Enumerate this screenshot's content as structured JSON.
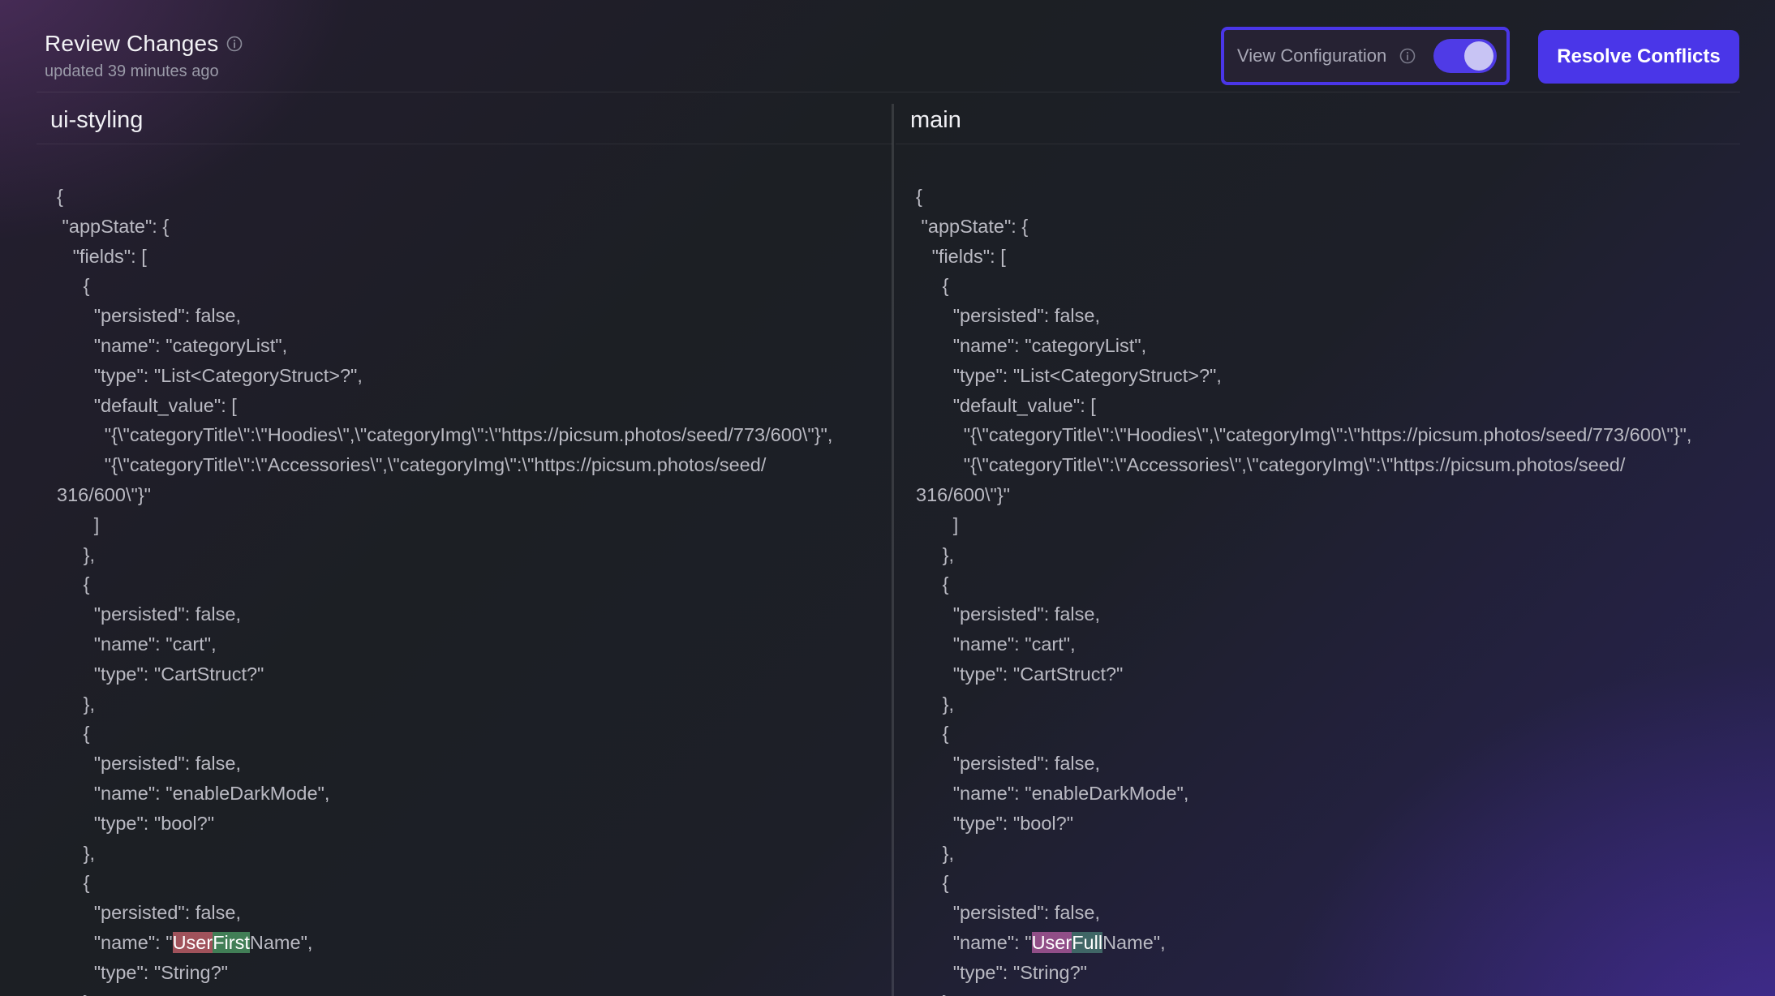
{
  "header": {
    "title": "Review Changes",
    "subtitle": "updated 39 minutes ago",
    "view_config_label": "View Configuration",
    "view_config_enabled": true,
    "resolve_label": "Resolve Conflicts",
    "info_icon": "info-icon"
  },
  "colors": {
    "accent": "#4a36e8",
    "toggle_knob": "#c8c4f4",
    "diff_removed": "#e86e78",
    "diff_added": "#5abe78"
  },
  "left_pane": {
    "branch": "ui-styling",
    "lines": [
      "{",
      " \"appState\": {",
      "   \"fields\": [",
      "     {",
      "       \"persisted\": false,",
      "       \"name\": \"categoryList\",",
      "       \"type\": \"List<CategoryStruct>?\",",
      "       \"default_value\": [",
      "         \"{\\\"categoryTitle\\\":\\\"Hoodies\\\",\\\"categoryImg\\\":\\\"https://picsum.photos/seed/773/600\\\"}\",",
      "         \"{\\\"categoryTitle\\\":\\\"Accessories\\\",\\\"categoryImg\\\":\\\"https://picsum.photos/seed/",
      "316/600\\\"}\"",
      "       ]",
      "     },",
      "     {",
      "       \"persisted\": false,",
      "       \"name\": \"cart\",",
      "       \"type\": \"CartStruct?\"",
      "     },",
      "     {",
      "       \"persisted\": false,",
      "       \"name\": \"enableDarkMode\",",
      "       \"type\": \"bool?\"",
      "     },",
      "     {",
      "       \"persisted\": false,"
    ],
    "diff_line": {
      "prefix": "       \"name\": \"",
      "seg1": "User",
      "seg2": "First",
      "suffix": "Name\","
    },
    "after_lines": [
      "       \"type\": \"String?\"",
      "     }"
    ]
  },
  "right_pane": {
    "branch": "main",
    "lines": [
      "{",
      " \"appState\": {",
      "   \"fields\": [",
      "     {",
      "       \"persisted\": false,",
      "       \"name\": \"categoryList\",",
      "       \"type\": \"List<CategoryStruct>?\",",
      "       \"default_value\": [",
      "         \"{\\\"categoryTitle\\\":\\\"Hoodies\\\",\\\"categoryImg\\\":\\\"https://picsum.photos/seed/773/600\\\"}\",",
      "         \"{\\\"categoryTitle\\\":\\\"Accessories\\\",\\\"categoryImg\\\":\\\"https://picsum.photos/seed/",
      "316/600\\\"}\"",
      "       ]",
      "     },",
      "     {",
      "       \"persisted\": false,",
      "       \"name\": \"cart\",",
      "       \"type\": \"CartStruct?\"",
      "     },",
      "     {",
      "       \"persisted\": false,",
      "       \"name\": \"enableDarkMode\",",
      "       \"type\": \"bool?\"",
      "     },",
      "     {",
      "       \"persisted\": false,"
    ],
    "diff_line": {
      "prefix": "       \"name\": \"",
      "seg1": "User",
      "seg2": "Full",
      "suffix": "Name\","
    },
    "after_lines": [
      "       \"type\": \"String?\"",
      "     }"
    ]
  }
}
